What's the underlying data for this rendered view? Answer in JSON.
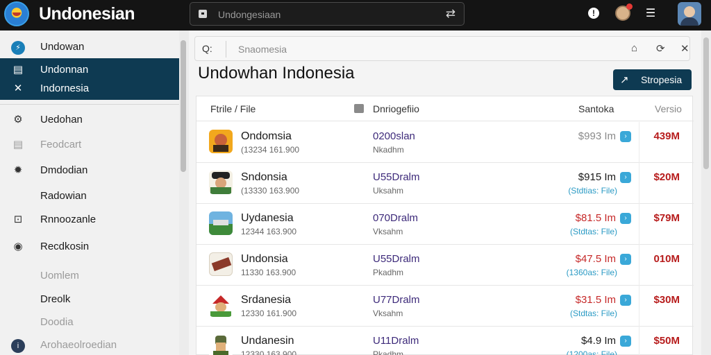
{
  "app": {
    "title": "Undonesian"
  },
  "topbar": {
    "search_value": "Undongesiaan",
    "icons": [
      "lock-icon",
      "swap-icon",
      "help-icon",
      "bell-icon",
      "list-icon",
      "avatar"
    ]
  },
  "sidebar": {
    "items": [
      {
        "label": "Undowan",
        "icon": "compass-icon"
      },
      {
        "label": "Undonnan",
        "icon": "list-icon"
      },
      {
        "label": "Indornesia",
        "icon": "shuffle-icon"
      },
      {
        "label": "Uedohan",
        "icon": "gear-icon"
      },
      {
        "label": "Feodcart",
        "icon": "grid-icon"
      },
      {
        "label": "Dmdodian",
        "icon": "settings-icon"
      },
      {
        "label": "Radowian",
        "icon": ""
      },
      {
        "label": "Rnnoozanle",
        "icon": "square-icon"
      },
      {
        "label": "Recdkosin",
        "icon": "eye-icon"
      },
      {
        "label": "Uomlem",
        "icon": ""
      },
      {
        "label": "Dreolk",
        "icon": ""
      },
      {
        "label": "Doodia",
        "icon": ""
      },
      {
        "label": "Arohaeolroedian",
        "icon": "info-icon"
      }
    ]
  },
  "main": {
    "search_placeholder": "Snaomesia",
    "search_prefix": "Q:",
    "title": "Undowhan Indonesia",
    "primary_button": "Stropesia",
    "columns": [
      "Ftrile / File",
      "Dnriogefiio",
      "Santoka",
      "Versio"
    ],
    "rows": [
      {
        "name": "Ondomsia",
        "sub": "(13234 161.900",
        "code": "0200slan",
        "code2": "Nkadhm",
        "price": "$993 Im",
        "note": "",
        "version": "439M",
        "price_color": "#8a8a8a"
      },
      {
        "name": "Sndonsia",
        "sub": "(13330 163.900",
        "code": "U55Dralm",
        "code2": "Uksahm",
        "price": "$915 Im",
        "note": "(Stdtias: File)",
        "version": "$20M",
        "price_color": "#1a1a1a"
      },
      {
        "name": "Uydanesia",
        "sub": "12344 163.900",
        "code": "070Dralm",
        "code2": "Vksahm",
        "price": "$81.5 Im",
        "note": "(Stdtas: Flle)",
        "version": "$79M",
        "price_color": "#c62828"
      },
      {
        "name": "Undonsia",
        "sub": "11330 163.900",
        "code": "U55Dralm",
        "code2": "Pkadhm",
        "price": "$47.5 Im",
        "note": "(1360as: File)",
        "version": "010M",
        "price_color": "#c62828"
      },
      {
        "name": "Srdanesia",
        "sub": "12330 161.900",
        "code": "U77Dralm",
        "code2": "Vksahm",
        "price": "$31.5 Im",
        "note": "(Stdtas: File)",
        "version": "$30M",
        "price_color": "#c62828"
      },
      {
        "name": "Undanesin",
        "sub": "12330 163.900",
        "code": "U11Dralm",
        "code2": "Pkadhm",
        "price": "$4.9 Im",
        "note": "(1200as: File)",
        "version": "$50M",
        "price_color": "#1a1a1a"
      }
    ]
  },
  "colors": {
    "accent": "#0e3a52",
    "badge": "#3aa8d8",
    "version_red": "#b71c1c"
  }
}
